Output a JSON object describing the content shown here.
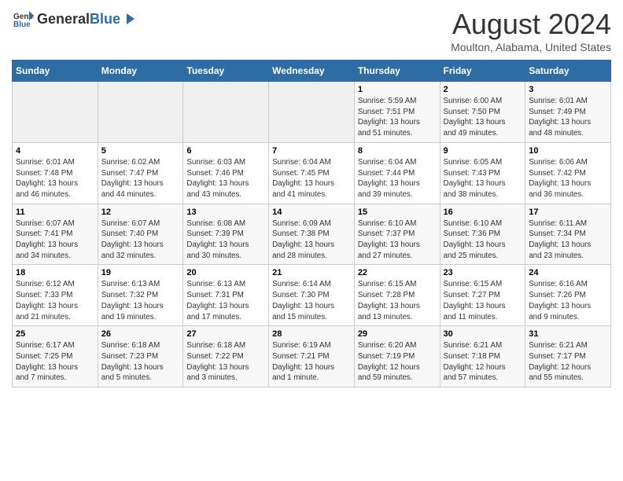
{
  "header": {
    "logo_general": "General",
    "logo_blue": "Blue",
    "title": "August 2024",
    "subtitle": "Moulton, Alabama, United States"
  },
  "days_of_week": [
    "Sunday",
    "Monday",
    "Tuesday",
    "Wednesday",
    "Thursday",
    "Friday",
    "Saturday"
  ],
  "weeks": [
    [
      {
        "num": "",
        "info": "",
        "empty": true
      },
      {
        "num": "",
        "info": "",
        "empty": true
      },
      {
        "num": "",
        "info": "",
        "empty": true
      },
      {
        "num": "",
        "info": "",
        "empty": true
      },
      {
        "num": "1",
        "info": "Sunrise: 5:59 AM\nSunset: 7:51 PM\nDaylight: 13 hours\nand 51 minutes.",
        "empty": false
      },
      {
        "num": "2",
        "info": "Sunrise: 6:00 AM\nSunset: 7:50 PM\nDaylight: 13 hours\nand 49 minutes.",
        "empty": false
      },
      {
        "num": "3",
        "info": "Sunrise: 6:01 AM\nSunset: 7:49 PM\nDaylight: 13 hours\nand 48 minutes.",
        "empty": false
      }
    ],
    [
      {
        "num": "4",
        "info": "Sunrise: 6:01 AM\nSunset: 7:48 PM\nDaylight: 13 hours\nand 46 minutes.",
        "empty": false
      },
      {
        "num": "5",
        "info": "Sunrise: 6:02 AM\nSunset: 7:47 PM\nDaylight: 13 hours\nand 44 minutes.",
        "empty": false
      },
      {
        "num": "6",
        "info": "Sunrise: 6:03 AM\nSunset: 7:46 PM\nDaylight: 13 hours\nand 43 minutes.",
        "empty": false
      },
      {
        "num": "7",
        "info": "Sunrise: 6:04 AM\nSunset: 7:45 PM\nDaylight: 13 hours\nand 41 minutes.",
        "empty": false
      },
      {
        "num": "8",
        "info": "Sunrise: 6:04 AM\nSunset: 7:44 PM\nDaylight: 13 hours\nand 39 minutes.",
        "empty": false
      },
      {
        "num": "9",
        "info": "Sunrise: 6:05 AM\nSunset: 7:43 PM\nDaylight: 13 hours\nand 38 minutes.",
        "empty": false
      },
      {
        "num": "10",
        "info": "Sunrise: 6:06 AM\nSunset: 7:42 PM\nDaylight: 13 hours\nand 36 minutes.",
        "empty": false
      }
    ],
    [
      {
        "num": "11",
        "info": "Sunrise: 6:07 AM\nSunset: 7:41 PM\nDaylight: 13 hours\nand 34 minutes.",
        "empty": false
      },
      {
        "num": "12",
        "info": "Sunrise: 6:07 AM\nSunset: 7:40 PM\nDaylight: 13 hours\nand 32 minutes.",
        "empty": false
      },
      {
        "num": "13",
        "info": "Sunrise: 6:08 AM\nSunset: 7:39 PM\nDaylight: 13 hours\nand 30 minutes.",
        "empty": false
      },
      {
        "num": "14",
        "info": "Sunrise: 6:09 AM\nSunset: 7:38 PM\nDaylight: 13 hours\nand 28 minutes.",
        "empty": false
      },
      {
        "num": "15",
        "info": "Sunrise: 6:10 AM\nSunset: 7:37 PM\nDaylight: 13 hours\nand 27 minutes.",
        "empty": false
      },
      {
        "num": "16",
        "info": "Sunrise: 6:10 AM\nSunset: 7:36 PM\nDaylight: 13 hours\nand 25 minutes.",
        "empty": false
      },
      {
        "num": "17",
        "info": "Sunrise: 6:11 AM\nSunset: 7:34 PM\nDaylight: 13 hours\nand 23 minutes.",
        "empty": false
      }
    ],
    [
      {
        "num": "18",
        "info": "Sunrise: 6:12 AM\nSunset: 7:33 PM\nDaylight: 13 hours\nand 21 minutes.",
        "empty": false
      },
      {
        "num": "19",
        "info": "Sunrise: 6:13 AM\nSunset: 7:32 PM\nDaylight: 13 hours\nand 19 minutes.",
        "empty": false
      },
      {
        "num": "20",
        "info": "Sunrise: 6:13 AM\nSunset: 7:31 PM\nDaylight: 13 hours\nand 17 minutes.",
        "empty": false
      },
      {
        "num": "21",
        "info": "Sunrise: 6:14 AM\nSunset: 7:30 PM\nDaylight: 13 hours\nand 15 minutes.",
        "empty": false
      },
      {
        "num": "22",
        "info": "Sunrise: 6:15 AM\nSunset: 7:28 PM\nDaylight: 13 hours\nand 13 minutes.",
        "empty": false
      },
      {
        "num": "23",
        "info": "Sunrise: 6:15 AM\nSunset: 7:27 PM\nDaylight: 13 hours\nand 11 minutes.",
        "empty": false
      },
      {
        "num": "24",
        "info": "Sunrise: 6:16 AM\nSunset: 7:26 PM\nDaylight: 13 hours\nand 9 minutes.",
        "empty": false
      }
    ],
    [
      {
        "num": "25",
        "info": "Sunrise: 6:17 AM\nSunset: 7:25 PM\nDaylight: 13 hours\nand 7 minutes.",
        "empty": false
      },
      {
        "num": "26",
        "info": "Sunrise: 6:18 AM\nSunset: 7:23 PM\nDaylight: 13 hours\nand 5 minutes.",
        "empty": false
      },
      {
        "num": "27",
        "info": "Sunrise: 6:18 AM\nSunset: 7:22 PM\nDaylight: 13 hours\nand 3 minutes.",
        "empty": false
      },
      {
        "num": "28",
        "info": "Sunrise: 6:19 AM\nSunset: 7:21 PM\nDaylight: 13 hours\nand 1 minute.",
        "empty": false
      },
      {
        "num": "29",
        "info": "Sunrise: 6:20 AM\nSunset: 7:19 PM\nDaylight: 12 hours\nand 59 minutes.",
        "empty": false
      },
      {
        "num": "30",
        "info": "Sunrise: 6:21 AM\nSunset: 7:18 PM\nDaylight: 12 hours\nand 57 minutes.",
        "empty": false
      },
      {
        "num": "31",
        "info": "Sunrise: 6:21 AM\nSunset: 7:17 PM\nDaylight: 12 hours\nand 55 minutes.",
        "empty": false
      }
    ]
  ]
}
